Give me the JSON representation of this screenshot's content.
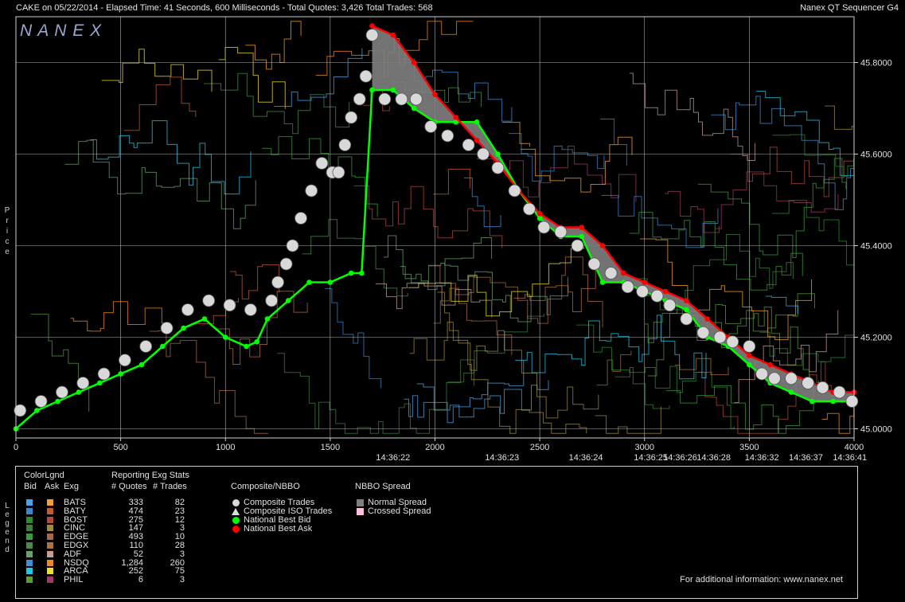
{
  "header": {
    "title_left": "CAKE on 05/22/2014  -  Elapsed Time: 41 Seconds, 600 Milliseconds  -  Total Quotes: 3,426  Total Trades: 568",
    "title_right": "Nanex QT Sequencer G4",
    "brand": "N A N E X"
  },
  "side_labels": {
    "price": "P\nr\ni\nc\ne",
    "legend": "L\ne\ng\ne\nn\nd"
  },
  "colors": {
    "nbbo_bid": "#00ff00",
    "nbbo_ask": "#ff0000",
    "normal_spread": "#7f7f7f",
    "crossed_spread": "#ffc0e0",
    "composite_trade": "#d9d9d9",
    "background": "#000000",
    "grid": "#b0b0b0"
  },
  "chart_data": {
    "type": "line",
    "title": "CAKE on 05/22/2014",
    "xlabel": "",
    "ylabel": "Price",
    "xlim": [
      0,
      4000
    ],
    "ylim": [
      44.98,
      45.9
    ],
    "x_ticks": [
      0,
      500,
      1000,
      1500,
      2000,
      2500,
      3000,
      3500,
      4000
    ],
    "y_ticks": [
      "45.0000",
      "45.2000",
      "45.4000",
      "45.6000",
      "45.8000"
    ],
    "y_tick_values": [
      45.0,
      45.2,
      45.4,
      45.6,
      45.8
    ],
    "time_labels": [
      {
        "x": 1800,
        "label": "14:36:22"
      },
      {
        "x": 2320,
        "label": "14:36:23"
      },
      {
        "x": 2720,
        "label": "14:36:24"
      },
      {
        "x": 3030,
        "label": "14:36:25"
      },
      {
        "x": 3170,
        "label": "14:36:26"
      },
      {
        "x": 3330,
        "label": "14:36:28"
      },
      {
        "x": 3560,
        "label": "14:36:32"
      },
      {
        "x": 3770,
        "label": "14:36:37"
      },
      {
        "x": 3980,
        "label": "14:36:41"
      }
    ],
    "series": [
      {
        "name": "National Best Bid",
        "color": "#00ff00",
        "x": [
          0,
          100,
          200,
          300,
          400,
          500,
          600,
          700,
          800,
          900,
          1000,
          1100,
          1150,
          1200,
          1300,
          1400,
          1500,
          1600,
          1650,
          1700,
          1800,
          1900,
          2000,
          2100,
          2200,
          2300,
          2400,
          2500,
          2600,
          2700,
          2800,
          2900,
          3000,
          3100,
          3200,
          3300,
          3400,
          3500,
          3600,
          3700,
          3800,
          3900,
          4000
        ],
        "y": [
          45.0,
          45.04,
          45.06,
          45.08,
          45.1,
          45.12,
          45.14,
          45.18,
          45.22,
          45.24,
          45.2,
          45.18,
          45.19,
          45.24,
          45.28,
          45.32,
          45.32,
          45.34,
          45.34,
          45.74,
          45.74,
          45.7,
          45.67,
          45.67,
          45.67,
          45.6,
          45.52,
          45.46,
          45.42,
          45.42,
          45.32,
          45.32,
          45.3,
          45.28,
          45.26,
          45.2,
          45.18,
          45.14,
          45.1,
          45.08,
          45.06,
          45.06,
          45.06
        ]
      },
      {
        "name": "National Best Ask",
        "color": "#ff0000",
        "x": [
          1700,
          1800,
          1900,
          2000,
          2100,
          2200,
          2300,
          2400,
          2500,
          2600,
          2700,
          2800,
          2900,
          3000,
          3100,
          3200,
          3300,
          3400,
          3500,
          3600,
          3700,
          3800,
          3900,
          4000
        ],
        "y": [
          45.88,
          45.86,
          45.8,
          45.73,
          45.68,
          45.63,
          45.58,
          45.52,
          45.47,
          45.44,
          45.44,
          45.4,
          45.34,
          45.32,
          45.3,
          45.28,
          45.24,
          45.2,
          45.16,
          45.14,
          45.12,
          45.1,
          45.08,
          45.08
        ]
      },
      {
        "name": "Composite Trades",
        "color": "#d9d9d9",
        "x": [
          20,
          120,
          220,
          320,
          420,
          520,
          620,
          720,
          820,
          920,
          1020,
          1120,
          1220,
          1250,
          1290,
          1320,
          1360,
          1410,
          1460,
          1510,
          1540,
          1570,
          1600,
          1640,
          1670,
          1700,
          1760,
          1840,
          1910,
          1980,
          2060,
          2160,
          2230,
          2300,
          2380,
          2450,
          2520,
          2600,
          2680,
          2760,
          2840,
          2920,
          2990,
          3060,
          3120,
          3200,
          3280,
          3360,
          3420,
          3500,
          3560,
          3620,
          3700,
          3780,
          3850,
          3930,
          3990
        ],
        "y": [
          45.04,
          45.06,
          45.08,
          45.1,
          45.12,
          45.15,
          45.18,
          45.22,
          45.26,
          45.28,
          45.27,
          45.26,
          45.28,
          45.32,
          45.36,
          45.4,
          45.46,
          45.52,
          45.58,
          45.56,
          45.56,
          45.62,
          45.68,
          45.72,
          45.77,
          45.86,
          45.72,
          45.72,
          45.72,
          45.66,
          45.64,
          45.62,
          45.6,
          45.57,
          45.52,
          45.48,
          45.44,
          45.43,
          45.4,
          45.36,
          45.34,
          45.31,
          45.3,
          45.29,
          45.27,
          45.24,
          45.21,
          45.2,
          45.19,
          45.18,
          45.12,
          45.11,
          45.11,
          45.1,
          45.09,
          45.08,
          45.06
        ]
      }
    ]
  },
  "legend": {
    "title_colorlgnd": "ColorLgnd",
    "title_stats": "Reporting Exg Stats",
    "col_bid": "Bid",
    "col_ask": "Ask",
    "col_exg": "Exg",
    "col_quotes": "# Quotes",
    "col_trades": "# Trades",
    "exchanges": [
      {
        "name": "BATS",
        "quotes": "333",
        "trades": "82",
        "bid": "#4aa3e6",
        "ask": "#f0a030"
      },
      {
        "name": "BATY",
        "quotes": "474",
        "trades": "23",
        "bid": "#3a86c8",
        "ask": "#c85a30"
      },
      {
        "name": "BOST",
        "quotes": "275",
        "trades": "12",
        "bid": "#2e8a2e",
        "ask": "#b04a3a"
      },
      {
        "name": "CINC",
        "quotes": "147",
        "trades": "3",
        "bid": "#3d7d3d",
        "ask": "#a08a40"
      },
      {
        "name": "EDGE",
        "quotes": "493",
        "trades": "10",
        "bid": "#3c9a3c",
        "ask": "#a86848"
      },
      {
        "name": "EDGX",
        "quotes": "110",
        "trades": "28",
        "bid": "#4a8a4a",
        "ask": "#b07040"
      },
      {
        "name": "ADF",
        "quotes": "52",
        "trades": "3",
        "bid": "#6aa06a",
        "ask": "#c89a98"
      },
      {
        "name": "NSDQ",
        "quotes": "1,284",
        "trades": "260",
        "bid": "#4090d8",
        "ask": "#f08a20"
      },
      {
        "name": "ARCA",
        "quotes": "252",
        "trades": "75",
        "bid": "#20c8e8",
        "ask": "#f0e020"
      },
      {
        "name": "PHIL",
        "quotes": "6",
        "trades": "3",
        "bid": "#5a9a3a",
        "ask": "#a03a6a"
      }
    ],
    "composite_title": "Composite/NBBO",
    "composite_items": [
      "Composite Trades",
      "Composite ISO Trades",
      "National Best Bid",
      "National Best Ask"
    ],
    "spread_title": "NBBO Spread",
    "spread_items": [
      "Normal Spread",
      "Crossed Spread"
    ],
    "footer": "For additional information: www.nanex.net"
  }
}
